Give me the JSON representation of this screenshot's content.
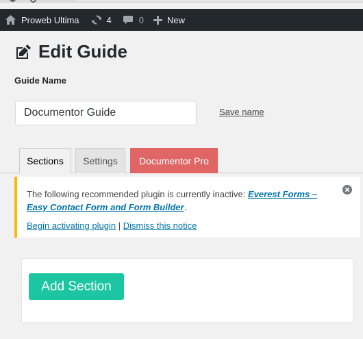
{
  "admin_bar": {
    "site_name": "Proweb Ultima",
    "updates_count": "4",
    "comments_count": "0",
    "new_label": "New"
  },
  "page": {
    "title": "Edit Guide",
    "guide_name_label": "Guide Name",
    "guide_name_value": "Documentor Guide",
    "save_name_link": "Save name"
  },
  "tabs": [
    {
      "label": "Sections",
      "active": true
    },
    {
      "label": "Settings",
      "active": false
    },
    {
      "label": "Documentor Pro",
      "active": false
    }
  ],
  "notice": {
    "text_before": "The following recommended plugin is currently inactive: ",
    "plugin_link": "Everest Forms – Easy Contact Form and Form Builder",
    "text_after": ".",
    "activate_link": "Begin activating plugin",
    "separator": " | ",
    "dismiss_link": "Dismiss this notice"
  },
  "panel": {
    "add_section_label": "Add Section"
  },
  "colors": {
    "admin_bar_bg": "#23282d",
    "notice_border": "#ffb900",
    "pro_tab_bg": "#e06666",
    "add_button_bg": "#1cc6a3",
    "link": "#0073aa"
  },
  "icons": {
    "site": "home-icon",
    "updates": "refresh-icon",
    "comments": "comment-icon",
    "new": "plus-icon",
    "title": "edit-icon",
    "dismiss": "close-circle-icon"
  }
}
